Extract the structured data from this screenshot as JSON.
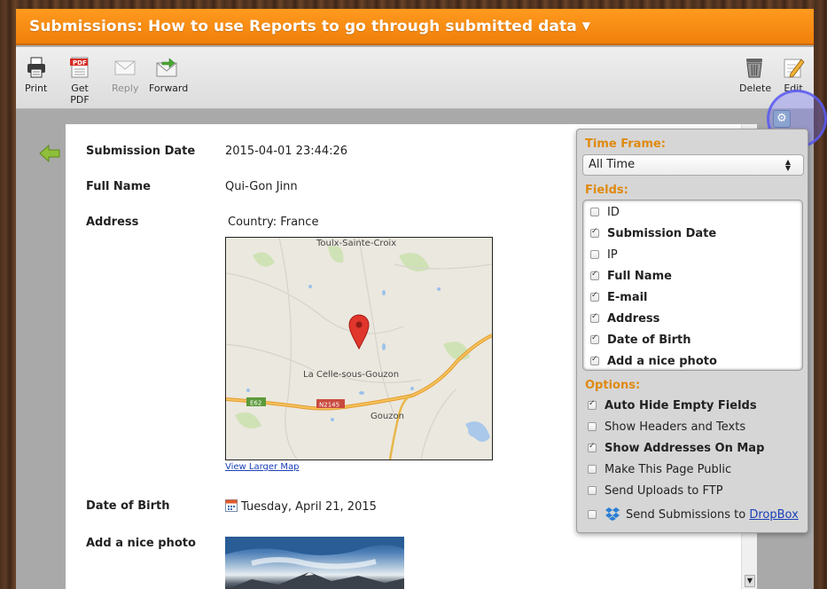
{
  "title": "Submissions: How to use Reports to go through submitted data",
  "toolbar": {
    "print": "Print",
    "get_pdf": "Get PDF",
    "pdf_badge": "PDF",
    "reply": "Reply",
    "forward": "Forward",
    "delete": "Delete",
    "edit": "Edit"
  },
  "submission": {
    "fields": [
      {
        "label": "Submission Date",
        "value": "2015-04-01 23:44:26"
      },
      {
        "label": "Full Name",
        "value": "Qui-Gon Jinn"
      },
      {
        "label": "Address",
        "value": "Country: France"
      },
      {
        "label": "Date of Birth",
        "value": "Tuesday, April 21, 2015"
      },
      {
        "label": "Add a nice photo",
        "value": ""
      }
    ],
    "map": {
      "place_top": "Toulx-Sainte-Croix",
      "place_center": "La Celle-sous-Gouzon",
      "place_bottom": "Gouzon",
      "road_1": "E62",
      "road_2": "N2145",
      "link": "View Larger Map"
    }
  },
  "settings": {
    "gear": "⚙",
    "time_frame_label": "Time Frame:",
    "time_frame_value": "All Time",
    "fields_label": "Fields:",
    "fields": [
      {
        "label": "ID",
        "checked": false
      },
      {
        "label": "Submission Date",
        "checked": true
      },
      {
        "label": "IP",
        "checked": false
      },
      {
        "label": "Full Name",
        "checked": true
      },
      {
        "label": "E-mail",
        "checked": true
      },
      {
        "label": "Address",
        "checked": true
      },
      {
        "label": "Date of Birth",
        "checked": true
      },
      {
        "label": "Add a nice photo",
        "checked": true
      }
    ],
    "options_label": "Options:",
    "options": [
      {
        "label": "Auto Hide Empty Fields",
        "checked": true
      },
      {
        "label": "Show Headers and Texts",
        "checked": false
      },
      {
        "label": "Show Addresses On Map",
        "checked": true
      },
      {
        "label": "Make This Page Public",
        "checked": false
      },
      {
        "label": "Send Uploads to FTP",
        "checked": false
      },
      {
        "label": "Send Submissions to",
        "link": "DropBox",
        "checked": false
      }
    ]
  },
  "colors": {
    "accent": "#f58a0f",
    "panel_heading": "#e08a10",
    "link": "#1a3fb8",
    "map_pin": "#e0362c",
    "road": "#f0a531"
  }
}
